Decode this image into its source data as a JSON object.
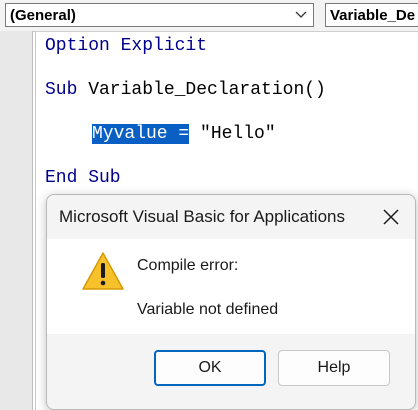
{
  "toolbar": {
    "object_combo": "(General)",
    "procedure_combo": "Variable_De"
  },
  "code": {
    "line1_kw": "Option Explicit",
    "line2_kw": "Sub",
    "line2_rest": " Variable_Declaration()",
    "line3_selected": "Myvalue =",
    "line3_rest": " \"Hello\"",
    "line4_kw": "End Sub"
  },
  "dialog": {
    "title": "Microsoft Visual Basic for Applications",
    "message_line1": "Compile error:",
    "message_line2": "Variable not defined",
    "ok_label": "OK",
    "help_label": "Help",
    "icon": "warning-icon"
  },
  "colors": {
    "keyword": "#00008b",
    "selection": "#0a5fc4",
    "default_button_border": "#0067c0"
  }
}
